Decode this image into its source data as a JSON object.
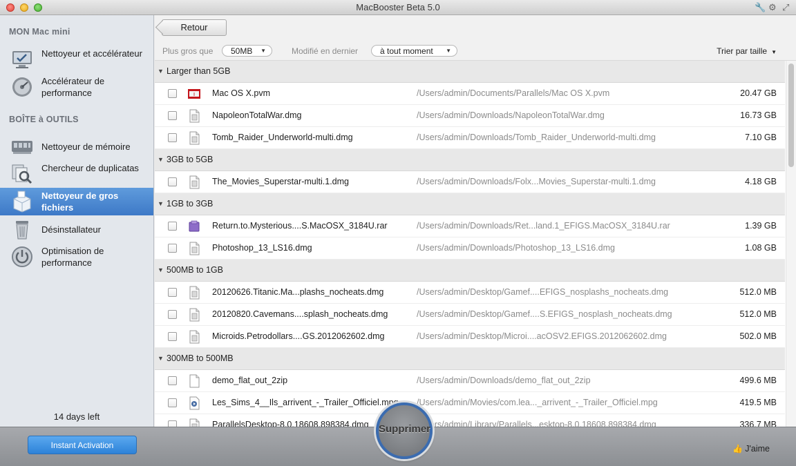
{
  "window": {
    "title": "MacBooster Beta 5.0"
  },
  "sidebar": {
    "section_mac": "MON Mac mini",
    "mac_items": [
      {
        "label": "Nettoyeur et accélérateur",
        "icon": "monitor-check-icon"
      },
      {
        "label": "Accélérateur de performance",
        "icon": "disk-speed-icon"
      }
    ],
    "section_tools": "BOÎTE à OUTILS",
    "tool_items": [
      {
        "label": "Nettoyeur de mémoire",
        "icon": "memory-chip-icon"
      },
      {
        "label": "Chercheur de duplicatas",
        "icon": "duplicate-search-icon"
      },
      {
        "label": "Nettoyeur de gros fichiers",
        "icon": "big-file-box-icon",
        "active": true
      },
      {
        "label": "Désinstallateur",
        "icon": "trash-icon"
      },
      {
        "label": "Optimisation de performance",
        "icon": "power-icon"
      }
    ],
    "trial_text": "14 days left"
  },
  "toolbar": {
    "back_label": "Retour",
    "filter_size_label": "Plus gros que",
    "filter_size_value": "50MB",
    "filter_date_label": "Modifié en dernier",
    "filter_date_value": "à tout moment",
    "sort_label": "Trier par taille"
  },
  "groups": [
    {
      "label": "Larger than 5GB",
      "files": [
        {
          "name": "Mac OS X.pvm",
          "path": "/Users/admin/Documents/Parallels/Mac OS X.pvm",
          "size": "20.47 GB",
          "icon": "parallels-icon"
        },
        {
          "name": "NapoleonTotalWar.dmg",
          "path": "/Users/admin/Downloads/NapoleonTotalWar.dmg",
          "size": "16.73 GB",
          "icon": "document-icon"
        },
        {
          "name": "Tomb_Raider_Underworld-multi.dmg",
          "path": "/Users/admin/Downloads/Tomb_Raider_Underworld-multi.dmg",
          "size": "7.10 GB",
          "icon": "document-icon"
        }
      ]
    },
    {
      "label": "3GB to 5GB",
      "files": [
        {
          "name": "The_Movies_Superstar-multi.1.dmg",
          "path": "/Users/admin/Downloads/Folx...Movies_Superstar-multi.1.dmg",
          "size": "4.18 GB",
          "icon": "document-icon"
        }
      ]
    },
    {
      "label": "1GB to 3GB",
      "files": [
        {
          "name": "Return.to.Mysterious....S.MacOSX_3184U.rar",
          "path": "/Users/admin/Downloads/Ret...land.1_EFIGS.MacOSX_3184U.rar",
          "size": "1.39 GB",
          "icon": "rar-archive-icon"
        },
        {
          "name": "Photoshop_13_LS16.dmg",
          "path": "/Users/admin/Downloads/Photoshop_13_LS16.dmg",
          "size": "1.08 GB",
          "icon": "document-icon"
        }
      ]
    },
    {
      "label": "500MB to 1GB",
      "files": [
        {
          "name": "20120626.Titanic.Ma...plashs_nocheats.dmg",
          "path": "/Users/admin/Desktop/Gamef....EFIGS_nosplashs_nocheats.dmg",
          "size": "512.0 MB",
          "icon": "document-icon"
        },
        {
          "name": "20120820.Cavemans....splash_nocheats.dmg",
          "path": "/Users/admin/Desktop/Gamef....S.EFIGS_nosplash_nocheats.dmg",
          "size": "512.0 MB",
          "icon": "document-icon"
        },
        {
          "name": "Microids.Petrodollars....GS.2012062602.dmg",
          "path": "/Users/admin/Desktop/Microi....acOSV2.EFIGS.2012062602.dmg",
          "size": "502.0 MB",
          "icon": "document-icon"
        }
      ]
    },
    {
      "label": "300MB to 500MB",
      "files": [
        {
          "name": "demo_flat_out_2zip",
          "path": "/Users/admin/Downloads/demo_flat_out_2zip",
          "size": "499.6 MB",
          "icon": "blank-document-icon"
        },
        {
          "name": "Les_Sims_4__Ils_arrivent_-_Trailer_Officiel.mpg",
          "path": "/Users/admin/Movies/com.lea..._arrivent_-_Trailer_Officiel.mpg",
          "size": "419.5 MB",
          "icon": "video-file-icon"
        },
        {
          "name": "ParallelsDesktop-8.0.18608.898384.dmg",
          "path": "/Users/admin/Library/Parallels...esktop-8.0.18608.898384.dmg",
          "size": "336.7 MB",
          "icon": "document-icon"
        }
      ]
    }
  ],
  "bottom": {
    "activate_label": "Instant Activation",
    "delete_label": "Supprimer",
    "like_label": "J'aime"
  }
}
